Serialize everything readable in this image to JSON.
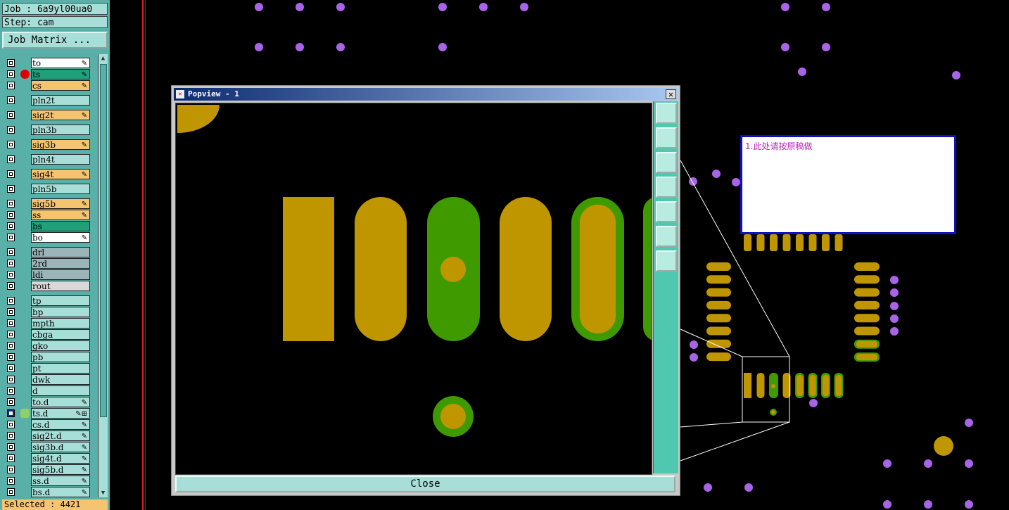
{
  "job": {
    "label": "Job : 6a9yl00ua0",
    "step": "Step: cam"
  },
  "matrix_button": "Job Matrix ...",
  "layers": [
    {
      "name": "to",
      "color": "#ffffff",
      "mark": "✎",
      "checked": false
    },
    {
      "name": "ts",
      "color": "#1fa07a",
      "mark": "✎",
      "checked": false,
      "active": true
    },
    {
      "name": "cs",
      "color": "#f4c470",
      "mark": "✎",
      "checked": false
    },
    {
      "name": "pln2t",
      "color": "#a8ded8",
      "mark": "",
      "checked": false,
      "gap": true
    },
    {
      "name": "sig2t",
      "color": "#f4c470",
      "mark": "✎",
      "checked": false,
      "gap": true
    },
    {
      "name": "pln3b",
      "color": "#a8ded8",
      "mark": "",
      "checked": false,
      "gap": true
    },
    {
      "name": "sig3b",
      "color": "#f4c470",
      "mark": "✎",
      "checked": false,
      "gap": true
    },
    {
      "name": "pln4t",
      "color": "#a8ded8",
      "mark": "",
      "checked": false,
      "gap": true
    },
    {
      "name": "sig4t",
      "color": "#f4c470",
      "mark": "✎",
      "checked": false,
      "gap": true
    },
    {
      "name": "pln5b",
      "color": "#a8ded8",
      "mark": "",
      "checked": false,
      "gap": true
    },
    {
      "name": "sig5b",
      "color": "#f4c470",
      "mark": "✎",
      "checked": false,
      "gap": true
    },
    {
      "name": "ss",
      "color": "#f4c470",
      "mark": "✎",
      "checked": false
    },
    {
      "name": "bs",
      "color": "#1fa07a",
      "mark": "",
      "checked": false
    },
    {
      "name": "bo",
      "color": "#ffffff",
      "mark": "✎",
      "checked": false
    },
    {
      "name": "drl",
      "color": "#9ab4b8",
      "mark": "",
      "checked": false,
      "gap": true
    },
    {
      "name": "2rd",
      "color": "#9ab4b8",
      "mark": "",
      "checked": false
    },
    {
      "name": "ldi",
      "color": "#9ab4b8",
      "mark": "",
      "checked": false
    },
    {
      "name": "rout",
      "color": "#d8d8d8",
      "mark": "",
      "checked": false
    },
    {
      "name": "tp",
      "color": "#a8ded8",
      "mark": "",
      "checked": false,
      "gap": true
    },
    {
      "name": "bp",
      "color": "#a8ded8",
      "mark": "",
      "checked": false
    },
    {
      "name": "mpth",
      "color": "#a8ded8",
      "mark": "",
      "checked": false
    },
    {
      "name": "cbga",
      "color": "#a8ded8",
      "mark": "",
      "checked": false
    },
    {
      "name": "gko",
      "color": "#a8ded8",
      "mark": "",
      "checked": false
    },
    {
      "name": "pb",
      "color": "#a8ded8",
      "mark": "",
      "checked": false
    },
    {
      "name": "pt",
      "color": "#a8ded8",
      "mark": "",
      "checked": false
    },
    {
      "name": "dwk",
      "color": "#a8ded8",
      "mark": "",
      "checked": false
    },
    {
      "name": "d",
      "color": "#a8ded8",
      "mark": "",
      "checked": false
    },
    {
      "name": "to.d",
      "color": "#a8ded8",
      "mark": "✎",
      "checked": false
    },
    {
      "name": "ts.d",
      "color": "#a8ded8",
      "mark": "✎⊞",
      "checked": true,
      "workicon": true
    },
    {
      "name": "cs.d",
      "color": "#a8ded8",
      "mark": "✎",
      "checked": false
    },
    {
      "name": "sig2t.d",
      "color": "#a8ded8",
      "mark": "✎",
      "checked": false
    },
    {
      "name": "sig3b.d",
      "color": "#a8ded8",
      "mark": "✎",
      "checked": false
    },
    {
      "name": "sig4t.d",
      "color": "#a8ded8",
      "mark": "✎",
      "checked": false
    },
    {
      "name": "sig5b.d",
      "color": "#a8ded8",
      "mark": "✎",
      "checked": false
    },
    {
      "name": "ss.d",
      "color": "#a8ded8",
      "mark": "✎",
      "checked": false
    },
    {
      "name": "bs.d",
      "color": "#a8ded8",
      "mark": "✎",
      "checked": false
    }
  ],
  "status": "Selected : 4421",
  "popup": {
    "title": "Popview - 1",
    "close_label": "Close",
    "toolbar_icons": [
      "zoom-home-icon",
      "pan-up-icon",
      "pan-down-icon",
      "pan-left-icon",
      "pan-right-icon",
      "zoom-in-icon",
      "zoom-out-icon"
    ]
  },
  "note": {
    "text": "1.此处请按原稿做"
  },
  "colors": {
    "copper": "#bf9600",
    "mask": "#3f9a00",
    "pad_purple": "#a864e6",
    "panel": "#a8ded8",
    "accent": "#58b0a8"
  }
}
